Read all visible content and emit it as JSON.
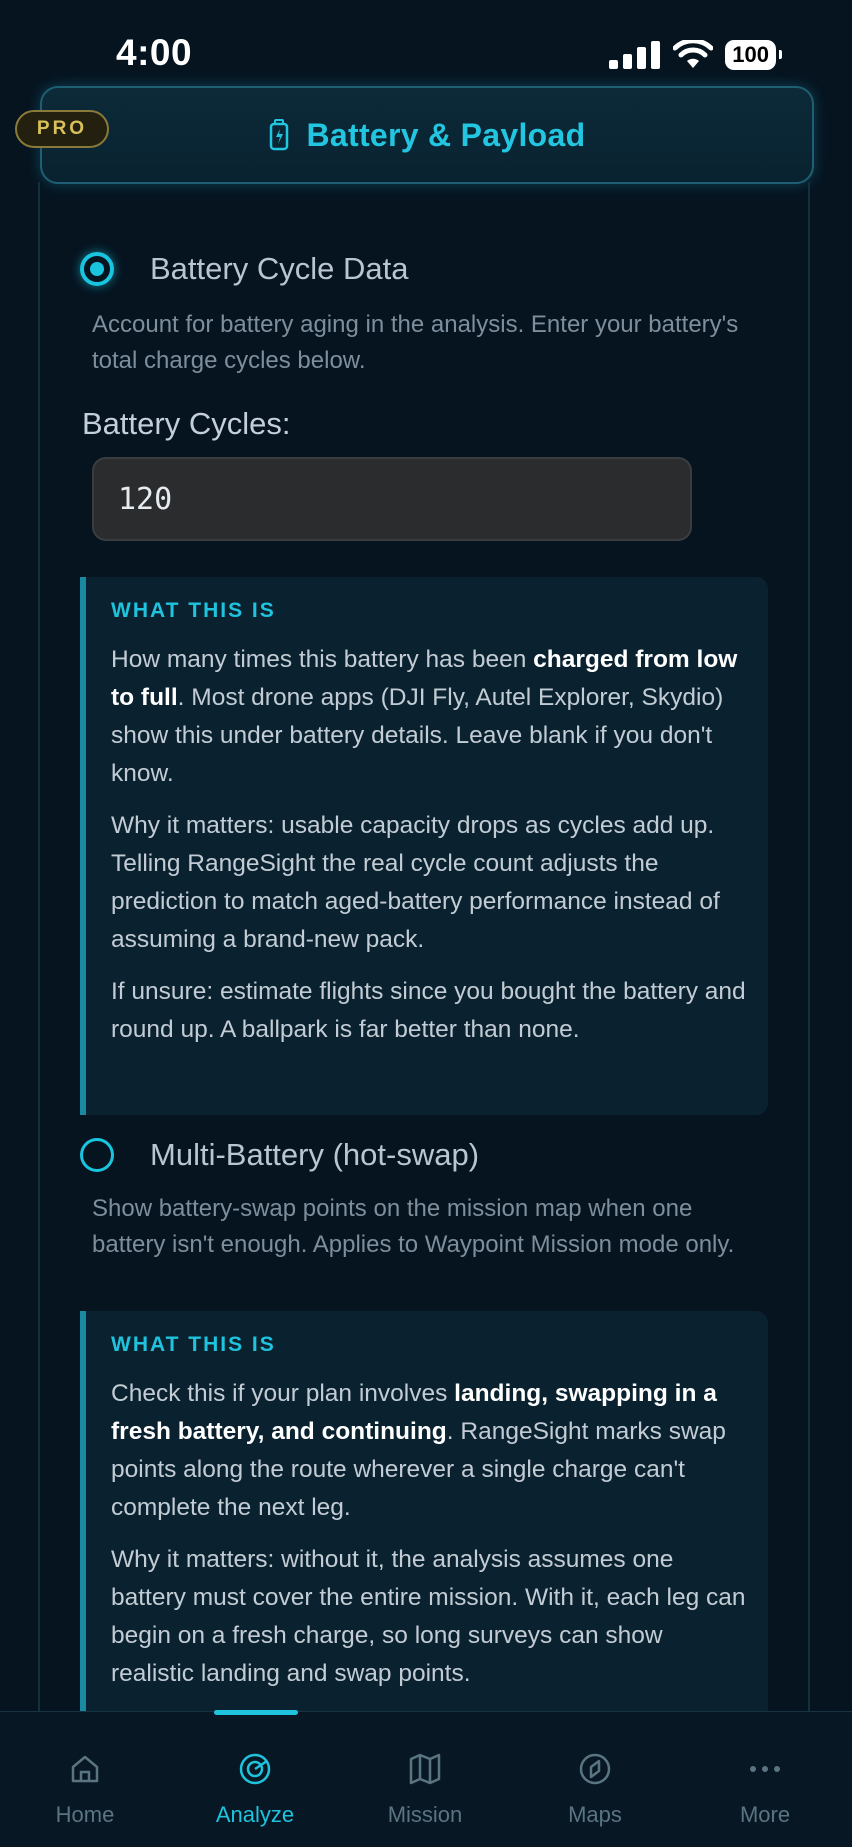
{
  "status": {
    "time": "4:00",
    "battery": "100"
  },
  "header": {
    "badge": "PRO",
    "title": "Battery & Payload"
  },
  "cycle_option": {
    "label": "Battery Cycle Data",
    "selected": true,
    "description": "Account for battery aging in the analysis. Enter your battery's total charge cycles below.",
    "field_label": "Battery Cycles:",
    "field_value": "120",
    "info": {
      "heading": "WHAT THIS IS",
      "p1_pre": "How many times this battery has been ",
      "p1_bold": "charged from low to full",
      "p1_post": ". Most drone apps (DJI Fly, Autel Explorer, Skydio) show this under battery details. Leave blank if you don't know.",
      "p2": "Why it matters: usable capacity drops as cycles add up. Telling RangeSight the real cycle count adjusts the prediction to match aged-battery performance instead of assuming a brand-new pack.",
      "p3": "If unsure: estimate flights since you bought the battery and round up. A ballpark is far better than none."
    }
  },
  "multi_option": {
    "label": "Multi-Battery (hot-swap)",
    "selected": false,
    "description": "Show battery-swap points on the mission map when one battery isn't enough. Applies to Waypoint Mission mode only.",
    "info": {
      "heading": "WHAT THIS IS",
      "p1_pre": "Check this if your plan involves ",
      "p1_bold": "landing, swapping in a fresh battery, and continuing",
      "p1_post": ". RangeSight marks swap points along the route wherever a single charge can't complete the next leg.",
      "p2": "Why it matters: without it, the analysis assumes one battery must cover the entire mission. With it, each leg can begin on a fresh charge, so long surveys can show realistic landing and swap points."
    }
  },
  "tabs": [
    {
      "label": "Home",
      "icon": "home-icon",
      "active": false
    },
    {
      "label": "Analyze",
      "icon": "analyze-icon",
      "active": true
    },
    {
      "label": "Mission",
      "icon": "map-fold-icon",
      "active": false
    },
    {
      "label": "Maps",
      "icon": "compass-icon",
      "active": false
    },
    {
      "label": "More",
      "icon": "more-dots-icon",
      "active": false
    }
  ],
  "colors": {
    "accent": "#1fc3dd",
    "background": "#061420",
    "pro_badge": "#d8c15a"
  }
}
